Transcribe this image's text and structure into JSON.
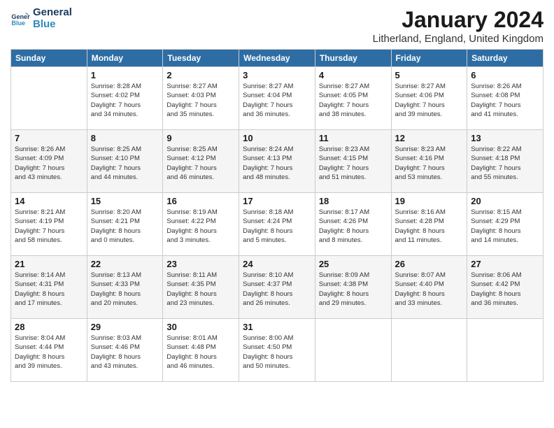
{
  "header": {
    "logo_line1": "General",
    "logo_line2": "Blue",
    "month_title": "January 2024",
    "location": "Litherland, England, United Kingdom"
  },
  "days_of_week": [
    "Sunday",
    "Monday",
    "Tuesday",
    "Wednesday",
    "Thursday",
    "Friday",
    "Saturday"
  ],
  "weeks": [
    [
      {
        "day": "",
        "info": ""
      },
      {
        "day": "1",
        "info": "Sunrise: 8:28 AM\nSunset: 4:02 PM\nDaylight: 7 hours\nand 34 minutes."
      },
      {
        "day": "2",
        "info": "Sunrise: 8:27 AM\nSunset: 4:03 PM\nDaylight: 7 hours\nand 35 minutes."
      },
      {
        "day": "3",
        "info": "Sunrise: 8:27 AM\nSunset: 4:04 PM\nDaylight: 7 hours\nand 36 minutes."
      },
      {
        "day": "4",
        "info": "Sunrise: 8:27 AM\nSunset: 4:05 PM\nDaylight: 7 hours\nand 38 minutes."
      },
      {
        "day": "5",
        "info": "Sunrise: 8:27 AM\nSunset: 4:06 PM\nDaylight: 7 hours\nand 39 minutes."
      },
      {
        "day": "6",
        "info": "Sunrise: 8:26 AM\nSunset: 4:08 PM\nDaylight: 7 hours\nand 41 minutes."
      }
    ],
    [
      {
        "day": "7",
        "info": "Sunrise: 8:26 AM\nSunset: 4:09 PM\nDaylight: 7 hours\nand 43 minutes."
      },
      {
        "day": "8",
        "info": "Sunrise: 8:25 AM\nSunset: 4:10 PM\nDaylight: 7 hours\nand 44 minutes."
      },
      {
        "day": "9",
        "info": "Sunrise: 8:25 AM\nSunset: 4:12 PM\nDaylight: 7 hours\nand 46 minutes."
      },
      {
        "day": "10",
        "info": "Sunrise: 8:24 AM\nSunset: 4:13 PM\nDaylight: 7 hours\nand 48 minutes."
      },
      {
        "day": "11",
        "info": "Sunrise: 8:23 AM\nSunset: 4:15 PM\nDaylight: 7 hours\nand 51 minutes."
      },
      {
        "day": "12",
        "info": "Sunrise: 8:23 AM\nSunset: 4:16 PM\nDaylight: 7 hours\nand 53 minutes."
      },
      {
        "day": "13",
        "info": "Sunrise: 8:22 AM\nSunset: 4:18 PM\nDaylight: 7 hours\nand 55 minutes."
      }
    ],
    [
      {
        "day": "14",
        "info": "Sunrise: 8:21 AM\nSunset: 4:19 PM\nDaylight: 7 hours\nand 58 minutes."
      },
      {
        "day": "15",
        "info": "Sunrise: 8:20 AM\nSunset: 4:21 PM\nDaylight: 8 hours\nand 0 minutes."
      },
      {
        "day": "16",
        "info": "Sunrise: 8:19 AM\nSunset: 4:22 PM\nDaylight: 8 hours\nand 3 minutes."
      },
      {
        "day": "17",
        "info": "Sunrise: 8:18 AM\nSunset: 4:24 PM\nDaylight: 8 hours\nand 5 minutes."
      },
      {
        "day": "18",
        "info": "Sunrise: 8:17 AM\nSunset: 4:26 PM\nDaylight: 8 hours\nand 8 minutes."
      },
      {
        "day": "19",
        "info": "Sunrise: 8:16 AM\nSunset: 4:28 PM\nDaylight: 8 hours\nand 11 minutes."
      },
      {
        "day": "20",
        "info": "Sunrise: 8:15 AM\nSunset: 4:29 PM\nDaylight: 8 hours\nand 14 minutes."
      }
    ],
    [
      {
        "day": "21",
        "info": "Sunrise: 8:14 AM\nSunset: 4:31 PM\nDaylight: 8 hours\nand 17 minutes."
      },
      {
        "day": "22",
        "info": "Sunrise: 8:13 AM\nSunset: 4:33 PM\nDaylight: 8 hours\nand 20 minutes."
      },
      {
        "day": "23",
        "info": "Sunrise: 8:11 AM\nSunset: 4:35 PM\nDaylight: 8 hours\nand 23 minutes."
      },
      {
        "day": "24",
        "info": "Sunrise: 8:10 AM\nSunset: 4:37 PM\nDaylight: 8 hours\nand 26 minutes."
      },
      {
        "day": "25",
        "info": "Sunrise: 8:09 AM\nSunset: 4:38 PM\nDaylight: 8 hours\nand 29 minutes."
      },
      {
        "day": "26",
        "info": "Sunrise: 8:07 AM\nSunset: 4:40 PM\nDaylight: 8 hours\nand 33 minutes."
      },
      {
        "day": "27",
        "info": "Sunrise: 8:06 AM\nSunset: 4:42 PM\nDaylight: 8 hours\nand 36 minutes."
      }
    ],
    [
      {
        "day": "28",
        "info": "Sunrise: 8:04 AM\nSunset: 4:44 PM\nDaylight: 8 hours\nand 39 minutes."
      },
      {
        "day": "29",
        "info": "Sunrise: 8:03 AM\nSunset: 4:46 PM\nDaylight: 8 hours\nand 43 minutes."
      },
      {
        "day": "30",
        "info": "Sunrise: 8:01 AM\nSunset: 4:48 PM\nDaylight: 8 hours\nand 46 minutes."
      },
      {
        "day": "31",
        "info": "Sunrise: 8:00 AM\nSunset: 4:50 PM\nDaylight: 8 hours\nand 50 minutes."
      },
      {
        "day": "",
        "info": ""
      },
      {
        "day": "",
        "info": ""
      },
      {
        "day": "",
        "info": ""
      }
    ]
  ]
}
